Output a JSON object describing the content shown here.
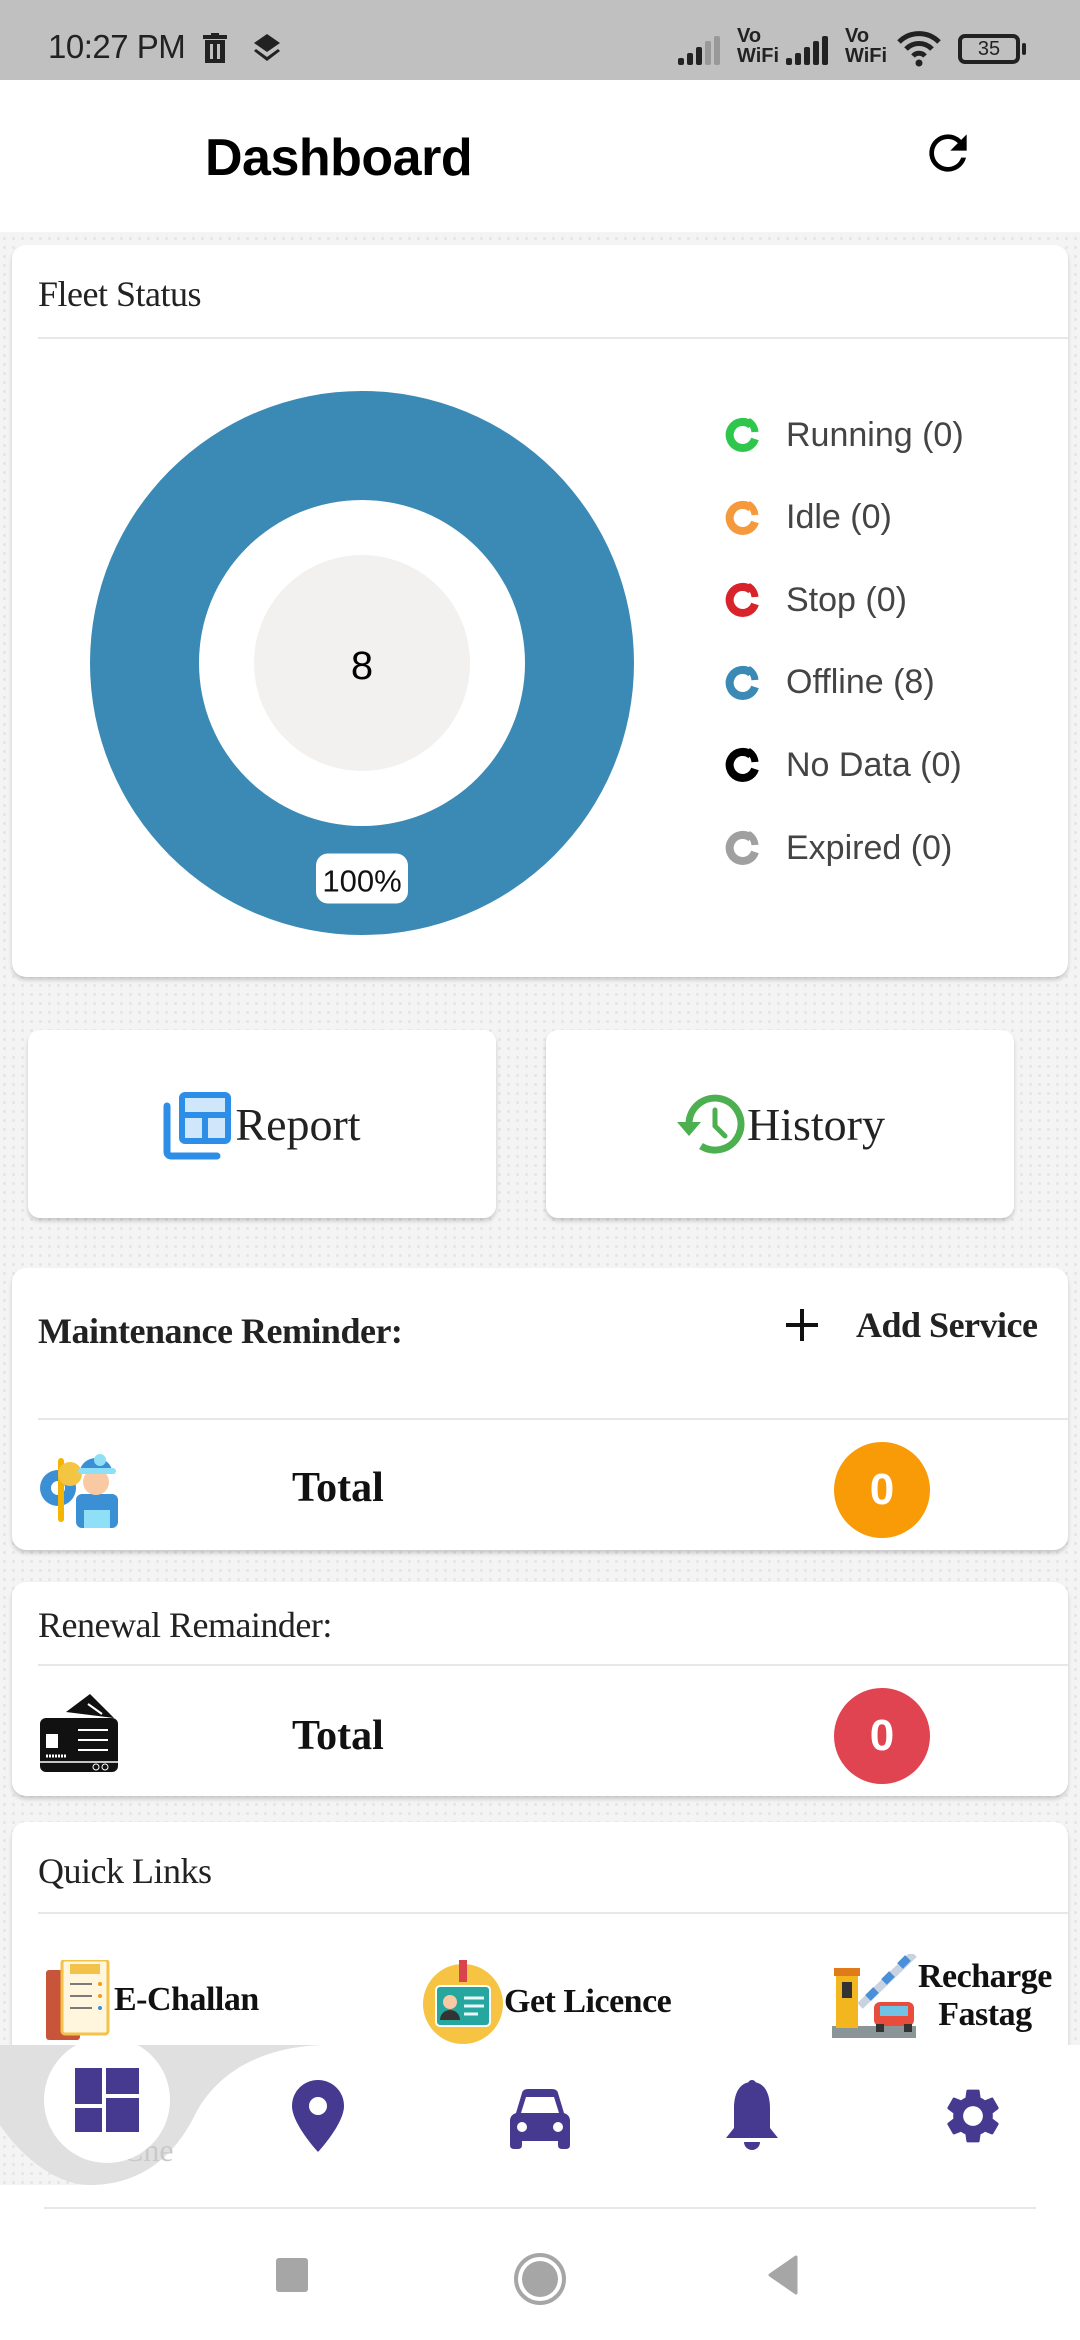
{
  "status_bar": {
    "time": "10:27 PM",
    "left_icons": [
      "trash-icon",
      "layers-icon"
    ],
    "right_icons": [
      "signal-icon",
      "vowifi-icon",
      "signal-icon",
      "vowifi-icon",
      "wifi-icon",
      "battery-icon"
    ],
    "vowifi_top": "Vo",
    "vowifi_bottom": "WiFi",
    "battery": "35"
  },
  "header": {
    "title": "Dashboard",
    "refresh_icon": "refresh-icon"
  },
  "fleet_status": {
    "title": "Fleet Status",
    "total": "8",
    "segment_label": "100%",
    "legend": [
      {
        "label": "Running (0)",
        "color": "#2ec64b"
      },
      {
        "label": "Idle (0)",
        "color": "#f59a3c"
      },
      {
        "label": "Stop (0)",
        "color": "#d9232a"
      },
      {
        "label": "Offline (8)",
        "color": "#3a8ab5"
      },
      {
        "label": "No Data (0)",
        "color": "#000000"
      },
      {
        "label": "Expired (0)",
        "color": "#a0a0a0"
      }
    ]
  },
  "chart_data": {
    "type": "pie",
    "title": "Fleet Status",
    "center_label": "8",
    "categories": [
      "Running",
      "Idle",
      "Stop",
      "Offline",
      "No Data",
      "Expired"
    ],
    "values": [
      0,
      0,
      0,
      8,
      0,
      0
    ],
    "colors": [
      "#2ec64b",
      "#f59a3c",
      "#d9232a",
      "#3a8ab5",
      "#000000",
      "#a0a0a0"
    ],
    "data_labels": [
      "",
      "",
      "",
      "100%",
      "",
      ""
    ],
    "legend_position": "right"
  },
  "actions": {
    "report_label": "Report",
    "history_label": "History"
  },
  "maintenance": {
    "title": "Maintenance Reminder:",
    "add_label": "Add Service",
    "total_label": "Total",
    "total_value": "0",
    "badge_color": "#f99b07"
  },
  "renewal": {
    "title": "Renewal Remainder:",
    "total_label": "Total",
    "total_value": "0",
    "badge_color": "#e04450"
  },
  "quick_links": {
    "title": "Quick Links",
    "items": [
      {
        "label": "E-Challan"
      },
      {
        "label": "Get Licence"
      },
      {
        "label_line1": "Recharge",
        "label_line2": "Fastag"
      }
    ],
    "partial_item": "Che"
  },
  "bottom_nav": {
    "accent": "#453a8f",
    "items": [
      "dashboard-icon",
      "location-icon",
      "car-icon",
      "bell-icon",
      "settings-icon"
    ]
  }
}
